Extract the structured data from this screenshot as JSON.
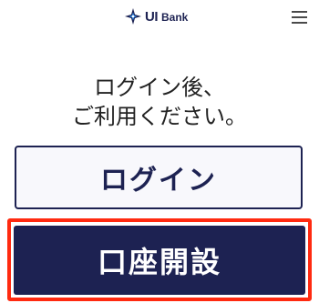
{
  "header": {
    "brand_ui": "UI",
    "brand_bank": "Bank",
    "logo_icon": "star-logo-icon",
    "menu_icon": "hamburger-menu-icon"
  },
  "prompt": {
    "line1": "ログイン後、",
    "line2": "ご利用ください。"
  },
  "buttons": {
    "login_label": "ログイン",
    "signup_label": "口座開設"
  },
  "colors": {
    "brand_navy": "#1d2252",
    "highlight_red": "#ff2a10",
    "login_bg": "#f8f8fc",
    "accent_star": "#2f8ff0"
  }
}
